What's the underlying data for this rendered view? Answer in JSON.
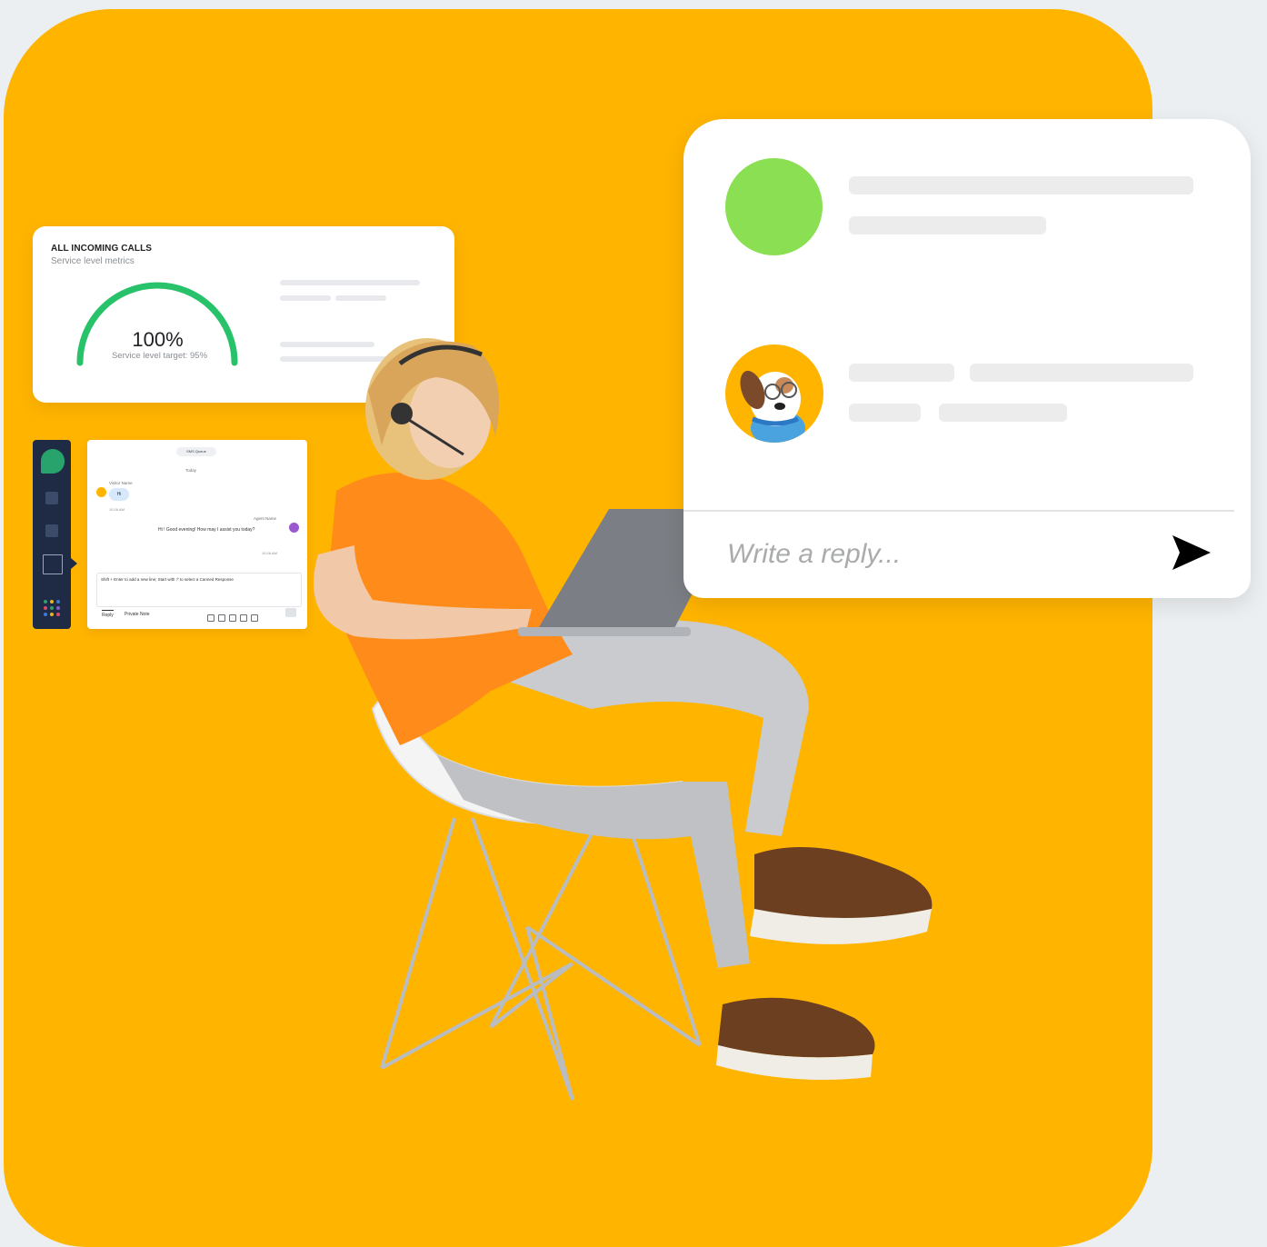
{
  "colors": {
    "accent": "#ffb400",
    "gauge": "#27c26a",
    "avatar_green": "#8ae052",
    "sidebar": "#1f2a44"
  },
  "metrics_card": {
    "title": "ALL INCOMING CALLS",
    "subtitle": "Service level metrics",
    "gauge_value": "100%",
    "gauge_fraction": 1.0,
    "target_label": "Service level target: 95%"
  },
  "chat_preview": {
    "queue_label": "SMS Queue",
    "date_label": "Today",
    "visitor_name": "Visitor Name",
    "visitor_message": "Hi",
    "visitor_time": "10:26 AM",
    "agent_name": "Agent Name",
    "agent_message": "Hi ! Good evening! How may I assist you today?",
    "agent_time": "10:26 AM",
    "composer_hint": "Shift + Enter to add a new line; Start with '/' to select a Canned Response",
    "tab_reply": "Reply",
    "tab_private_note": "Private Note"
  },
  "reply_card": {
    "placeholder": "Write a reply...",
    "send_icon": "send-icon",
    "agent_avatar": "dog-avatar-icon"
  }
}
